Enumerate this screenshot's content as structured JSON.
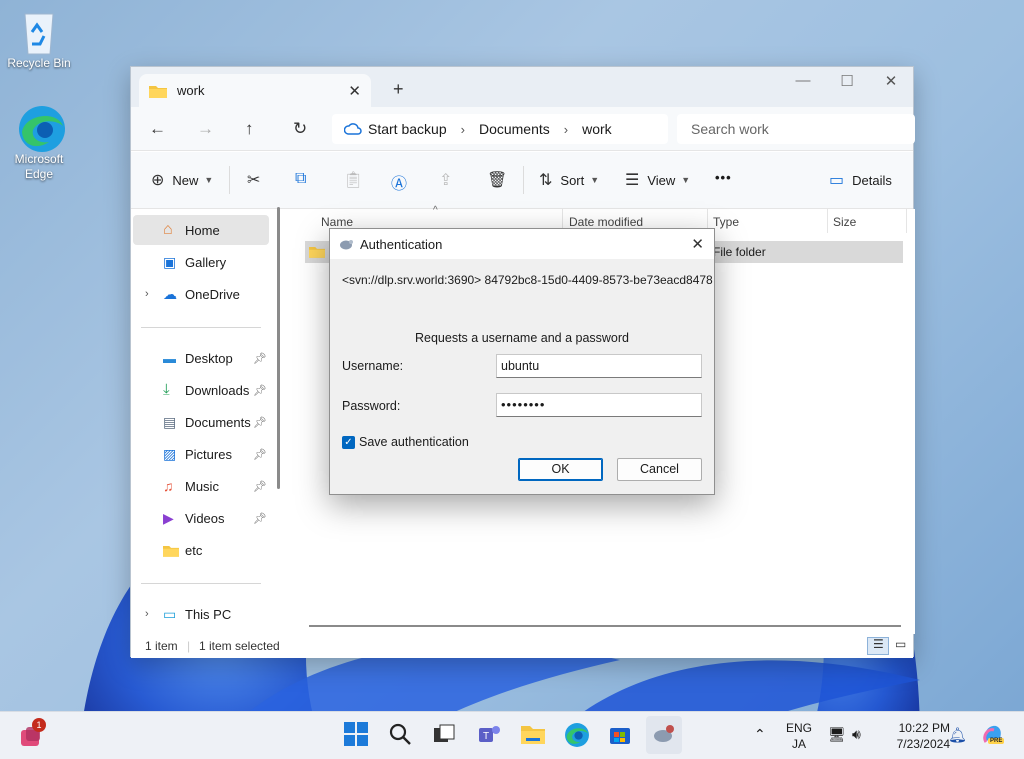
{
  "desktop": {
    "icons": [
      {
        "label": "Recycle Bin"
      },
      {
        "label": "Microsoft Edge"
      }
    ]
  },
  "explorer": {
    "tab_title": "work",
    "new_tab": "+",
    "window_controls": {
      "minimize": "—",
      "maximize": "☐",
      "close": "✕"
    },
    "breadcrumb": [
      "Start backup",
      "Documents",
      "work"
    ],
    "search_placeholder": "Search work",
    "toolbar": {
      "new": "New",
      "sort": "Sort",
      "view": "View",
      "more": "•••",
      "details": "Details"
    },
    "sidebar": {
      "home": "Home",
      "gallery": "Gallery",
      "onedrive": "OneDrive",
      "pinned": [
        {
          "label": "Desktop",
          "icon": "desktop-icon"
        },
        {
          "label": "Downloads",
          "icon": "download-icon"
        },
        {
          "label": "Documents",
          "icon": "document-icon"
        },
        {
          "label": "Pictures",
          "icon": "picture-icon"
        },
        {
          "label": "Music",
          "icon": "music-icon"
        },
        {
          "label": "Videos",
          "icon": "video-icon"
        },
        {
          "label": "etc",
          "icon": "folder-icon"
        }
      ],
      "this_pc": "This PC"
    },
    "columns": {
      "name": "Name",
      "date": "Date modified",
      "type": "Type",
      "size": "Size"
    },
    "rows": [
      {
        "type": "File folder"
      }
    ],
    "status": {
      "count": "1 item",
      "selected": "1 item selected"
    }
  },
  "dialog": {
    "title": "Authentication",
    "realm": "<svn://dlp.srv.world:3690> 84792bc8-15d0-4409-8573-be73eacd8478",
    "request": "Requests a username and a password",
    "username_label": "Username:",
    "username_value": "ubuntu",
    "password_label": "Password:",
    "password_value": "••••••••",
    "save_auth_label": "Save authentication",
    "save_auth_checked": true,
    "ok": "OK",
    "cancel": "Cancel"
  },
  "taskbar": {
    "badge": "1",
    "lang_top": "ENG",
    "lang_bottom": "JA",
    "time": "10:22 PM",
    "date": "7/23/2024",
    "copilot_badge": "PRE"
  },
  "colors": {
    "accent": "#0067c0",
    "selection": "#e5e5e5",
    "window_chrome": "#f7f9fb"
  }
}
